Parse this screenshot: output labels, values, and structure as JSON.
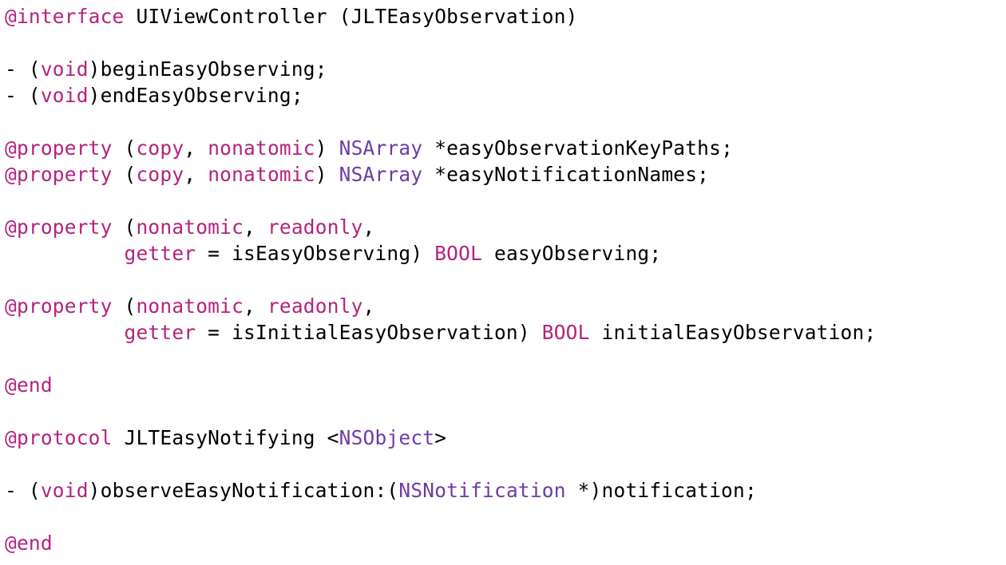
{
  "colors": {
    "keyword": "#b4237e",
    "type": "#6f3aa8",
    "plain": "#000000",
    "background": "#ffffff"
  },
  "lines": [
    [
      {
        "t": "@interface",
        "c": "kw"
      },
      {
        "t": " UIViewController (JLTEasyObservation)",
        "c": "plain"
      }
    ],
    [],
    [
      {
        "t": "- (",
        "c": "plain"
      },
      {
        "t": "void",
        "c": "kw"
      },
      {
        "t": ")beginEasyObserving;",
        "c": "plain"
      }
    ],
    [
      {
        "t": "- (",
        "c": "plain"
      },
      {
        "t": "void",
        "c": "kw"
      },
      {
        "t": ")endEasyObserving;",
        "c": "plain"
      }
    ],
    [],
    [
      {
        "t": "@property",
        "c": "kw"
      },
      {
        "t": " (",
        "c": "plain"
      },
      {
        "t": "copy",
        "c": "kw"
      },
      {
        "t": ", ",
        "c": "plain"
      },
      {
        "t": "nonatomic",
        "c": "kw"
      },
      {
        "t": ") ",
        "c": "plain"
      },
      {
        "t": "NSArray",
        "c": "type"
      },
      {
        "t": " *easyObservationKeyPaths;",
        "c": "plain"
      }
    ],
    [
      {
        "t": "@property",
        "c": "kw"
      },
      {
        "t": " (",
        "c": "plain"
      },
      {
        "t": "copy",
        "c": "kw"
      },
      {
        "t": ", ",
        "c": "plain"
      },
      {
        "t": "nonatomic",
        "c": "kw"
      },
      {
        "t": ") ",
        "c": "plain"
      },
      {
        "t": "NSArray",
        "c": "type"
      },
      {
        "t": " *easyNotificationNames;",
        "c": "plain"
      }
    ],
    [],
    [
      {
        "t": "@property",
        "c": "kw"
      },
      {
        "t": " (",
        "c": "plain"
      },
      {
        "t": "nonatomic",
        "c": "kw"
      },
      {
        "t": ", ",
        "c": "plain"
      },
      {
        "t": "readonly",
        "c": "kw"
      },
      {
        "t": ",",
        "c": "plain"
      }
    ],
    [
      {
        "t": "          ",
        "c": "plain"
      },
      {
        "t": "getter",
        "c": "kw"
      },
      {
        "t": " = isEasyObserving) ",
        "c": "plain"
      },
      {
        "t": "BOOL",
        "c": "kw"
      },
      {
        "t": " easyObserving;",
        "c": "plain"
      }
    ],
    [],
    [
      {
        "t": "@property",
        "c": "kw"
      },
      {
        "t": " (",
        "c": "plain"
      },
      {
        "t": "nonatomic",
        "c": "kw"
      },
      {
        "t": ", ",
        "c": "plain"
      },
      {
        "t": "readonly",
        "c": "kw"
      },
      {
        "t": ",",
        "c": "plain"
      }
    ],
    [
      {
        "t": "          ",
        "c": "plain"
      },
      {
        "t": "getter",
        "c": "kw"
      },
      {
        "t": " = isInitialEasyObservation) ",
        "c": "plain"
      },
      {
        "t": "BOOL",
        "c": "kw"
      },
      {
        "t": " initialEasyObservation;",
        "c": "plain"
      }
    ],
    [],
    [
      {
        "t": "@end",
        "c": "kw"
      }
    ],
    [],
    [
      {
        "t": "@protocol",
        "c": "kw"
      },
      {
        "t": " JLTEasyNotifying <",
        "c": "plain"
      },
      {
        "t": "NSObject",
        "c": "type"
      },
      {
        "t": ">",
        "c": "plain"
      }
    ],
    [],
    [
      {
        "t": "- (",
        "c": "plain"
      },
      {
        "t": "void",
        "c": "kw"
      },
      {
        "t": ")observeEasyNotification:(",
        "c": "plain"
      },
      {
        "t": "NSNotification",
        "c": "type"
      },
      {
        "t": " *)notification;",
        "c": "plain"
      }
    ],
    [],
    [
      {
        "t": "@end",
        "c": "kw"
      }
    ]
  ]
}
